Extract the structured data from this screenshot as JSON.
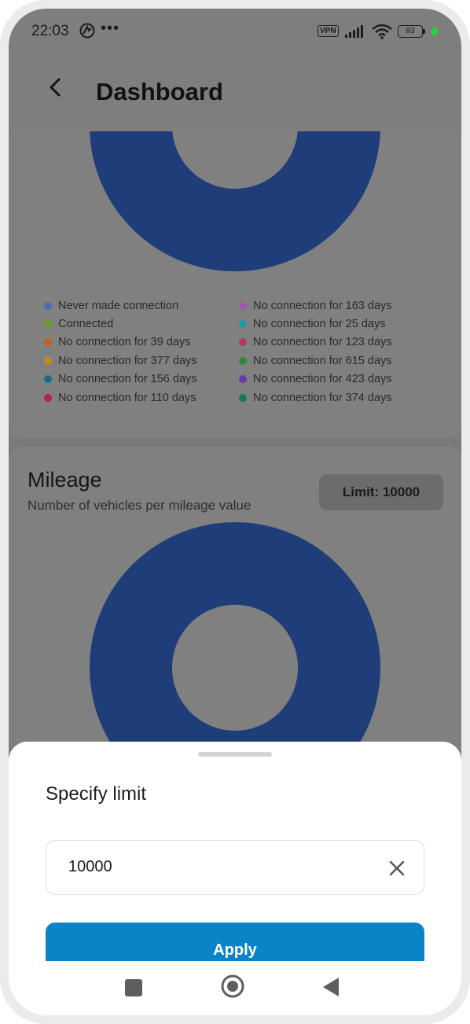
{
  "status_bar": {
    "time": "22:03",
    "dots": "•••",
    "vpn": "VPN",
    "battery": "83"
  },
  "app_bar": {
    "title": "Dashboard"
  },
  "connection_chart": {
    "legend": [
      {
        "label": "Never made connection",
        "color": "#4a6fb5"
      },
      {
        "label": "No connection for 163 days",
        "color": "#9b59b6"
      },
      {
        "label": "Connected",
        "color": "#6a9a2a"
      },
      {
        "label": "No connection for 25 days",
        "color": "#1e9aa0"
      },
      {
        "label": "No connection for 39 days",
        "color": "#c0601a"
      },
      {
        "label": "No connection for 123 days",
        "color": "#b03a6a"
      },
      {
        "label": "No connection for 377 days",
        "color": "#c08a1e"
      },
      {
        "label": "No connection for 615 days",
        "color": "#2e8a3e"
      },
      {
        "label": "No connection for 156 days",
        "color": "#1c6a8a"
      },
      {
        "label": "No connection for 423 days",
        "color": "#6a3aaa"
      },
      {
        "label": "No connection for 110 days",
        "color": "#b01e5a"
      },
      {
        "label": "No connection for 374 days",
        "color": "#1a7a4a"
      }
    ]
  },
  "mileage_card": {
    "title": "Mileage",
    "subtitle": "Number of vehicles per mileage value",
    "limit_chip": "Limit: 10000"
  },
  "sheet": {
    "title": "Specify limit",
    "input_value": "10000",
    "apply_label": "Apply"
  },
  "colors": {
    "donut_blue": "#1f3d78",
    "accent": "#0a84c6"
  }
}
